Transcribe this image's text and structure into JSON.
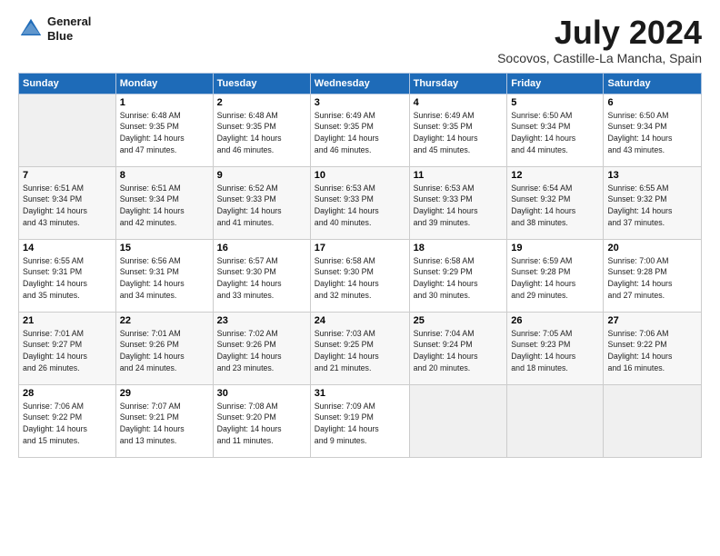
{
  "logo": {
    "line1": "General",
    "line2": "Blue"
  },
  "title": "July 2024",
  "location": "Socovos, Castille-La Mancha, Spain",
  "headers": [
    "Sunday",
    "Monday",
    "Tuesday",
    "Wednesday",
    "Thursday",
    "Friday",
    "Saturday"
  ],
  "weeks": [
    [
      {
        "day": "",
        "info": ""
      },
      {
        "day": "1",
        "info": "Sunrise: 6:48 AM\nSunset: 9:35 PM\nDaylight: 14 hours\nand 47 minutes."
      },
      {
        "day": "2",
        "info": "Sunrise: 6:48 AM\nSunset: 9:35 PM\nDaylight: 14 hours\nand 46 minutes."
      },
      {
        "day": "3",
        "info": "Sunrise: 6:49 AM\nSunset: 9:35 PM\nDaylight: 14 hours\nand 46 minutes."
      },
      {
        "day": "4",
        "info": "Sunrise: 6:49 AM\nSunset: 9:35 PM\nDaylight: 14 hours\nand 45 minutes."
      },
      {
        "day": "5",
        "info": "Sunrise: 6:50 AM\nSunset: 9:34 PM\nDaylight: 14 hours\nand 44 minutes."
      },
      {
        "day": "6",
        "info": "Sunrise: 6:50 AM\nSunset: 9:34 PM\nDaylight: 14 hours\nand 43 minutes."
      }
    ],
    [
      {
        "day": "7",
        "info": "Sunrise: 6:51 AM\nSunset: 9:34 PM\nDaylight: 14 hours\nand 43 minutes."
      },
      {
        "day": "8",
        "info": "Sunrise: 6:51 AM\nSunset: 9:34 PM\nDaylight: 14 hours\nand 42 minutes."
      },
      {
        "day": "9",
        "info": "Sunrise: 6:52 AM\nSunset: 9:33 PM\nDaylight: 14 hours\nand 41 minutes."
      },
      {
        "day": "10",
        "info": "Sunrise: 6:53 AM\nSunset: 9:33 PM\nDaylight: 14 hours\nand 40 minutes."
      },
      {
        "day": "11",
        "info": "Sunrise: 6:53 AM\nSunset: 9:33 PM\nDaylight: 14 hours\nand 39 minutes."
      },
      {
        "day": "12",
        "info": "Sunrise: 6:54 AM\nSunset: 9:32 PM\nDaylight: 14 hours\nand 38 minutes."
      },
      {
        "day": "13",
        "info": "Sunrise: 6:55 AM\nSunset: 9:32 PM\nDaylight: 14 hours\nand 37 minutes."
      }
    ],
    [
      {
        "day": "14",
        "info": "Sunrise: 6:55 AM\nSunset: 9:31 PM\nDaylight: 14 hours\nand 35 minutes."
      },
      {
        "day": "15",
        "info": "Sunrise: 6:56 AM\nSunset: 9:31 PM\nDaylight: 14 hours\nand 34 minutes."
      },
      {
        "day": "16",
        "info": "Sunrise: 6:57 AM\nSunset: 9:30 PM\nDaylight: 14 hours\nand 33 minutes."
      },
      {
        "day": "17",
        "info": "Sunrise: 6:58 AM\nSunset: 9:30 PM\nDaylight: 14 hours\nand 32 minutes."
      },
      {
        "day": "18",
        "info": "Sunrise: 6:58 AM\nSunset: 9:29 PM\nDaylight: 14 hours\nand 30 minutes."
      },
      {
        "day": "19",
        "info": "Sunrise: 6:59 AM\nSunset: 9:28 PM\nDaylight: 14 hours\nand 29 minutes."
      },
      {
        "day": "20",
        "info": "Sunrise: 7:00 AM\nSunset: 9:28 PM\nDaylight: 14 hours\nand 27 minutes."
      }
    ],
    [
      {
        "day": "21",
        "info": "Sunrise: 7:01 AM\nSunset: 9:27 PM\nDaylight: 14 hours\nand 26 minutes."
      },
      {
        "day": "22",
        "info": "Sunrise: 7:01 AM\nSunset: 9:26 PM\nDaylight: 14 hours\nand 24 minutes."
      },
      {
        "day": "23",
        "info": "Sunrise: 7:02 AM\nSunset: 9:26 PM\nDaylight: 14 hours\nand 23 minutes."
      },
      {
        "day": "24",
        "info": "Sunrise: 7:03 AM\nSunset: 9:25 PM\nDaylight: 14 hours\nand 21 minutes."
      },
      {
        "day": "25",
        "info": "Sunrise: 7:04 AM\nSunset: 9:24 PM\nDaylight: 14 hours\nand 20 minutes."
      },
      {
        "day": "26",
        "info": "Sunrise: 7:05 AM\nSunset: 9:23 PM\nDaylight: 14 hours\nand 18 minutes."
      },
      {
        "day": "27",
        "info": "Sunrise: 7:06 AM\nSunset: 9:22 PM\nDaylight: 14 hours\nand 16 minutes."
      }
    ],
    [
      {
        "day": "28",
        "info": "Sunrise: 7:06 AM\nSunset: 9:22 PM\nDaylight: 14 hours\nand 15 minutes."
      },
      {
        "day": "29",
        "info": "Sunrise: 7:07 AM\nSunset: 9:21 PM\nDaylight: 14 hours\nand 13 minutes."
      },
      {
        "day": "30",
        "info": "Sunrise: 7:08 AM\nSunset: 9:20 PM\nDaylight: 14 hours\nand 11 minutes."
      },
      {
        "day": "31",
        "info": "Sunrise: 7:09 AM\nSunset: 9:19 PM\nDaylight: 14 hours\nand 9 minutes."
      },
      {
        "day": "",
        "info": ""
      },
      {
        "day": "",
        "info": ""
      },
      {
        "day": "",
        "info": ""
      }
    ]
  ]
}
